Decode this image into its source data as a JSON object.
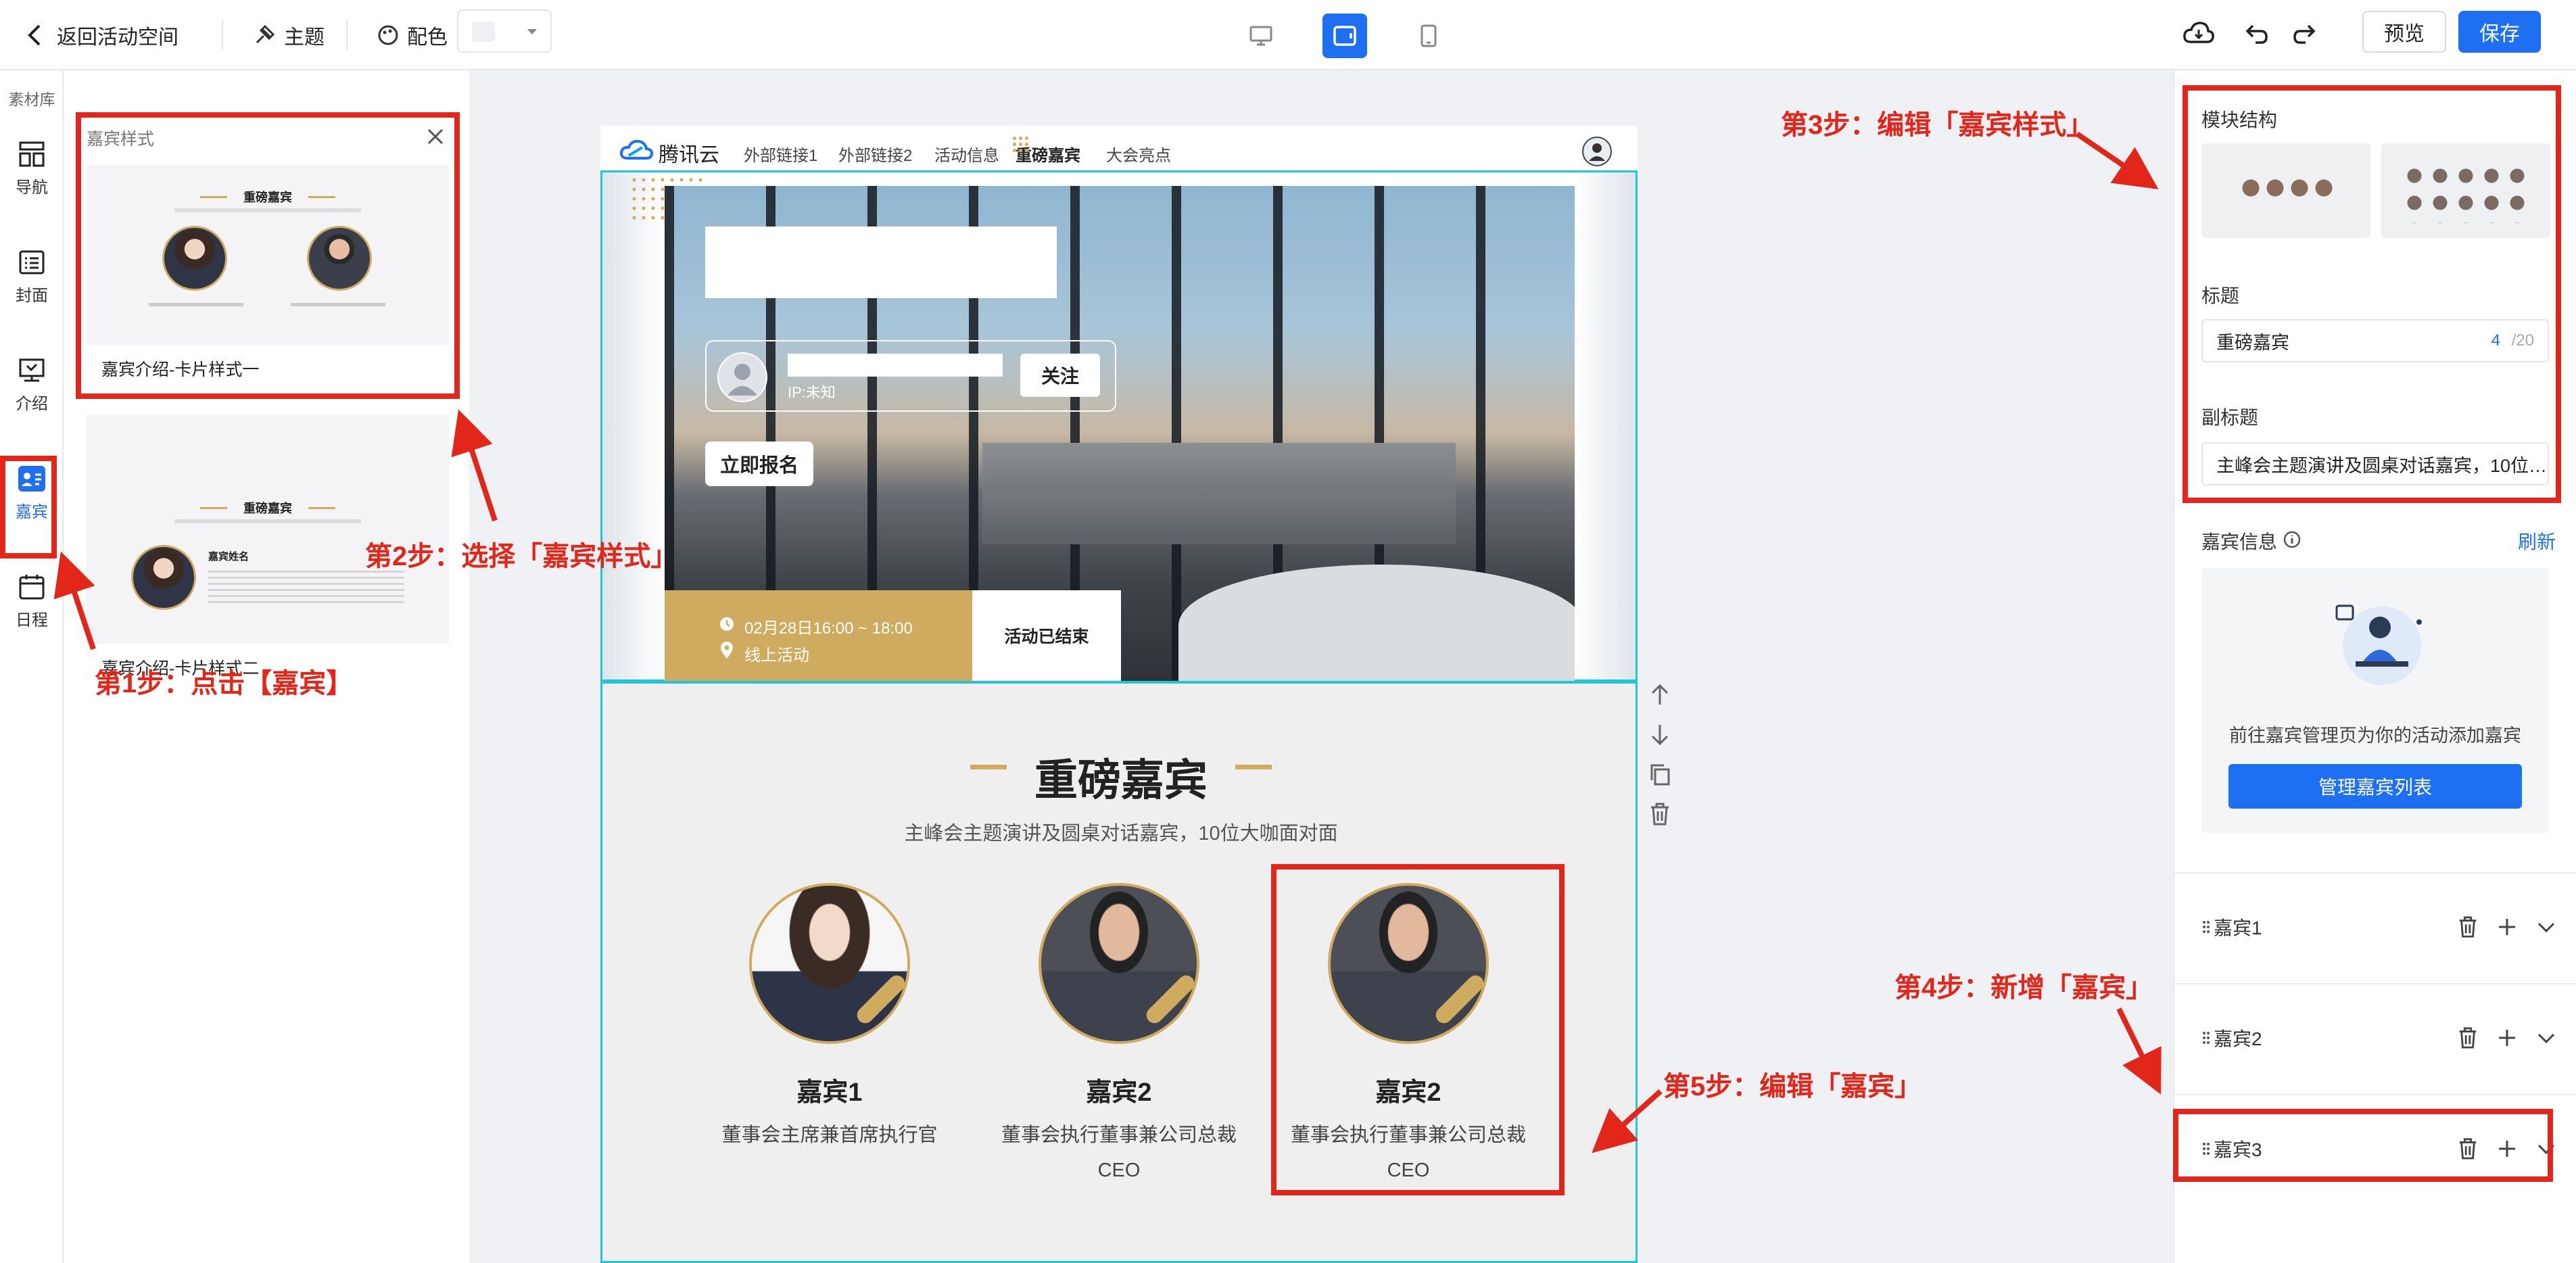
{
  "topbar": {
    "back": "返回活动空间",
    "theme": "主题",
    "color": "配色",
    "preview": "预览",
    "save": "保存"
  },
  "rail": {
    "library": "素材库",
    "items": [
      {
        "label": "导航",
        "icon": "nav-grid-icon"
      },
      {
        "label": "封面",
        "icon": "cover-icon"
      },
      {
        "label": "介绍",
        "icon": "intro-icon"
      },
      {
        "label": "嘉宾",
        "icon": "guest-icon",
        "active": true
      },
      {
        "label": "日程",
        "icon": "calendar-icon"
      }
    ]
  },
  "panel": {
    "title": "嘉宾样式",
    "templates": [
      {
        "caption": "嘉宾介绍-卡片样式一",
        "heading": "重磅嘉宾"
      },
      {
        "caption": "嘉宾介绍-卡片样式二",
        "heading": "重磅嘉宾",
        "guest_name": "嘉宾姓名"
      }
    ]
  },
  "page": {
    "nav": {
      "brand": "腾讯云",
      "links": [
        "外部链接1",
        "外部链接2",
        "活动信息",
        "重磅嘉宾",
        "大会亮点"
      ]
    },
    "hero": {
      "ip": "IP:未知",
      "follow": "关注",
      "register": "立即报名",
      "time": "02月28日16:00 ~ 18:00",
      "location": "线上活动",
      "status": "活动已结束"
    },
    "guests_section": {
      "title": "重磅嘉宾",
      "subtitle": "主峰会主题演讲及圆桌对话嘉宾，10位大咖面对面",
      "guests": [
        {
          "name": "嘉宾1",
          "desc": "董事会主席兼首席执行官",
          "desc2": ""
        },
        {
          "name": "嘉宾2",
          "desc": "董事会执行董事兼公司总裁",
          "desc2": "CEO"
        },
        {
          "name": "嘉宾2",
          "desc": "董事会执行董事兼公司总裁",
          "desc2": "CEO"
        }
      ]
    }
  },
  "right": {
    "module_structure": "模块结构",
    "title_label": "标题",
    "title_value": "重磅嘉宾",
    "title_count": "4",
    "title_max": "/20",
    "subtitle_label": "副标题",
    "subtitle_value": "主峰会主题演讲及圆桌对话嘉宾，10位…",
    "guest_info": "嘉宾信息",
    "refresh": "刷新",
    "empty_text": "前往嘉宾管理页为你的活动添加嘉宾",
    "manage_button": "管理嘉宾列表",
    "guest_rows": [
      "嘉宾1",
      "嘉宾2",
      "嘉宾3"
    ]
  },
  "annotations": {
    "step1": "第1步：点击【嘉宾】",
    "step2": "第2步：选择「嘉宾样式」",
    "step3": "第3步：编辑「嘉宾样式」",
    "step4": "第4步：新增「嘉宾」",
    "step5": "第5步：编辑「嘉宾」"
  },
  "colors": {
    "primary": "#1e6ff1",
    "gold": "#cfab5f",
    "annotation_red": "#e2261a",
    "canvas_bg": "#f0f1f4"
  }
}
